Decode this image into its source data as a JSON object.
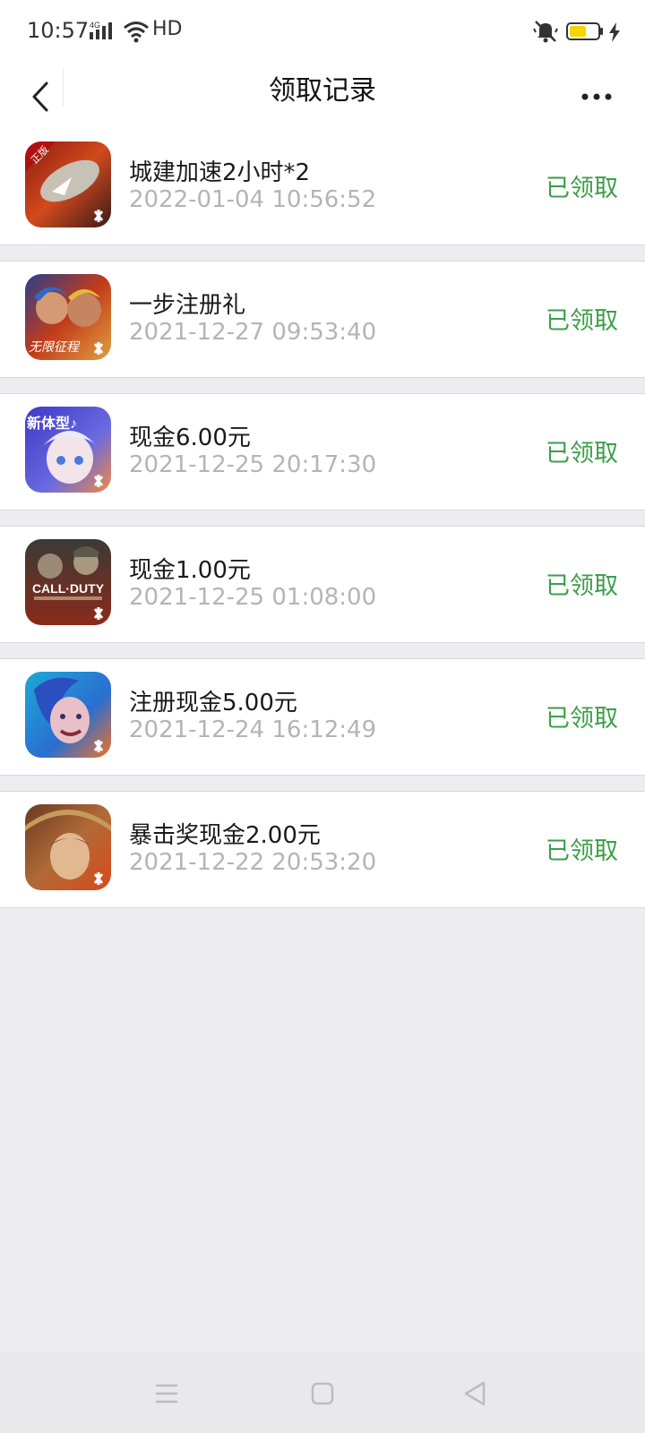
{
  "status_bar": {
    "time": "10:57",
    "network": "4G",
    "hd": "HD",
    "icons": [
      "signal-icon",
      "wifi-icon",
      "mute-icon",
      "battery-icon",
      "charging-icon"
    ],
    "battery_color": "#f5d400"
  },
  "header": {
    "title": "领取记录",
    "back_icon": "chevron-left-icon",
    "more_icon": "more-dots-icon"
  },
  "colors": {
    "status_green": "#3c9e48",
    "time_gray": "#b4b4b4",
    "background": "#ededf1"
  },
  "records": [
    {
      "title": "城建加速2小时*2",
      "time": "2022-01-04 10:56:52",
      "status": "已领取",
      "icon": "game-icon-airship",
      "icon_badge": "正版"
    },
    {
      "title": "一步注册礼",
      "time": "2021-12-27 09:53:40",
      "status": "已领取",
      "icon": "game-icon-warriors",
      "icon_badge": "无限征程"
    },
    {
      "title": "现金6.00元",
      "time": "2021-12-25 20:17:30",
      "status": "已领取",
      "icon": "game-icon-dance",
      "icon_badge": "新体型♪"
    },
    {
      "title": "现金1.00元",
      "time": "2021-12-25 01:08:00",
      "status": "已领取",
      "icon": "game-icon-call-of-duty",
      "icon_badge": "CALL·DUTY"
    },
    {
      "title": "注册现金5.00元",
      "time": "2021-12-24 16:12:49",
      "status": "已领取",
      "icon": "game-icon-jinx",
      "icon_badge": ""
    },
    {
      "title": "暴击奖现金2.00元",
      "time": "2021-12-22 20:53:20",
      "status": "已领取",
      "icon": "game-icon-swordsman",
      "icon_badge": ""
    }
  ],
  "nav_bar": {
    "icons": [
      "menu-icon",
      "home-icon",
      "back-triangle-icon"
    ]
  }
}
